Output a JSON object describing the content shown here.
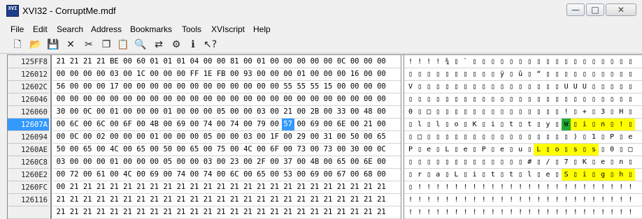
{
  "window": {
    "icon_label": "XVI",
    "title": "XVI32 - CorruptMe.mdf",
    "minimize": "—",
    "maximize": "□",
    "close": "✕"
  },
  "menu": [
    "File",
    "Edit",
    "Search",
    "Address",
    "Bookmarks",
    "Tools",
    "XVIscript",
    "Help"
  ],
  "toolbar": [
    {
      "name": "new-file-icon",
      "glyph": "🗋"
    },
    {
      "name": "open-folder-icon",
      "glyph": "📂"
    },
    {
      "name": "save-disk-icon",
      "glyph": "💾"
    },
    {
      "name": "delete-x-icon",
      "glyph": "✕"
    },
    {
      "name": "cut-scissors-icon",
      "glyph": "✂"
    },
    {
      "name": "copy-icon",
      "glyph": "❐"
    },
    {
      "name": "paste-clipboard-icon",
      "glyph": "📋"
    },
    {
      "name": "find-magnifier-icon",
      "glyph": "🔍"
    },
    {
      "name": "replace-icon",
      "glyph": "⇄"
    },
    {
      "name": "settings-icon",
      "glyph": "⚙"
    },
    {
      "name": "info-icon",
      "glyph": "ℹ"
    },
    {
      "name": "context-help-icon",
      "glyph": "↖?"
    }
  ],
  "colors": {
    "selection": "#3399ff",
    "highlight": "#ffff00",
    "cursor": "#22aa33"
  },
  "rows": [
    {
      "addr": "125FF8",
      "hex": [
        "21",
        "21",
        "21",
        "21",
        "BE",
        "00",
        "60",
        "01",
        "01",
        "01",
        "04",
        "00",
        "00",
        "81",
        "00",
        "01",
        "00",
        "00",
        "00",
        "00",
        "00",
        "0C",
        "00",
        "00",
        "00"
      ],
      "txt": [
        "!",
        "!",
        "!",
        "!",
        "¾",
        "▯",
        "`",
        "▯",
        "▯",
        "▯",
        "▯",
        "▯",
        "▯",
        "▯",
        "▯",
        "▯",
        "▯",
        "▯",
        "▯",
        "▯",
        "▯",
        "▯",
        "▯",
        "▯",
        "▯"
      ]
    },
    {
      "addr": "126012",
      "hex": [
        "00",
        "00",
        "00",
        "00",
        "03",
        "00",
        "1C",
        "00",
        "00",
        "00",
        "FF",
        "1E",
        "FB",
        "00",
        "93",
        "00",
        "00",
        "00",
        "01",
        "00",
        "00",
        "00",
        "16",
        "00",
        "00"
      ],
      "txt": [
        "▯",
        "▯",
        "▯",
        "▯",
        "▯",
        "▯",
        "▯",
        "▯",
        "▯",
        "▯",
        "ÿ",
        "▯",
        "û",
        "▯",
        "“",
        "▯",
        "▯",
        "▯",
        "▯",
        "▯",
        "▯",
        "▯",
        "▯",
        "▯",
        "▯"
      ]
    },
    {
      "addr": "12602C",
      "hex": [
        "56",
        "00",
        "00",
        "00",
        "17",
        "00",
        "00",
        "00",
        "00",
        "00",
        "00",
        "00",
        "00",
        "00",
        "00",
        "00",
        "00",
        "55",
        "55",
        "55",
        "15",
        "00",
        "00",
        "00",
        "00"
      ],
      "txt": [
        "V",
        "▯",
        "▯",
        "▯",
        "▯",
        "▯",
        "▯",
        "▯",
        "▯",
        "▯",
        "▯",
        "▯",
        "▯",
        "▯",
        "▯",
        "▯",
        "▯",
        "U",
        "U",
        "U",
        "▯",
        "▯",
        "▯",
        "▯",
        "▯"
      ]
    },
    {
      "addr": "126046",
      "hex": [
        "00",
        "00",
        "00",
        "00",
        "00",
        "00",
        "00",
        "00",
        "00",
        "00",
        "00",
        "00",
        "00",
        "00",
        "00",
        "00",
        "00",
        "00",
        "00",
        "00",
        "00",
        "00",
        "00",
        "00",
        "00"
      ],
      "txt": [
        "▯",
        "▯",
        "▯",
        "▯",
        "▯",
        "▯",
        "▯",
        "▯",
        "▯",
        "▯",
        "▯",
        "▯",
        "▯",
        "▯",
        "▯",
        "▯",
        "▯",
        "▯",
        "▯",
        "▯",
        "▯",
        "▯",
        "▯",
        "▯",
        "▯"
      ]
    },
    {
      "addr": "126060",
      "hex": [
        "30",
        "00",
        "0C",
        "00",
        "01",
        "00",
        "00",
        "00",
        "01",
        "00",
        "00",
        "00",
        "05",
        "00",
        "00",
        "03",
        "00",
        "21",
        "00",
        "2B",
        "00",
        "33",
        "00",
        "48",
        "00",
        "65"
      ],
      "txt": [
        "0",
        "▯",
        "□",
        "▯",
        "▯",
        "▯",
        "▯",
        "▯",
        "▯",
        "▯",
        "▯",
        "▯",
        "▯",
        "▯",
        "▯",
        "▯",
        "▯",
        "!",
        "▯",
        "+",
        "▯",
        "3",
        "▯",
        "H",
        "▯",
        "e"
      ]
    },
    {
      "addr": "12607A",
      "hex": [
        "00",
        "6C",
        "00",
        "6C",
        "00",
        "6F",
        "00",
        "4B",
        "00",
        "69",
        "00",
        "74",
        "00",
        "74",
        "00",
        "79",
        "00",
        "57",
        "00",
        "69",
        "00",
        "6E",
        "00",
        "21",
        "00",
        "30"
      ],
      "txt": [
        "▯",
        "l",
        "▯",
        "l",
        "▯",
        "o",
        "▯",
        "K",
        "▯",
        "i",
        "▯",
        "t",
        "▯",
        "t",
        "▯",
        "y",
        "▯",
        "W",
        "▯",
        "i",
        "▯",
        "n",
        "▯",
        "!",
        "▯",
        "0"
      ]
    },
    {
      "addr": "126094",
      "hex": [
        "00",
        "0C",
        "00",
        "02",
        "00",
        "00",
        "00",
        "01",
        "00",
        "00",
        "00",
        "05",
        "00",
        "00",
        "03",
        "00",
        "1F",
        "00",
        "29",
        "00",
        "31",
        "00",
        "50",
        "00",
        "65",
        "00"
      ],
      "txt": [
        "▯",
        "□",
        "▯",
        "▯",
        "▯",
        "▯",
        "▯",
        "▯",
        "▯",
        "▯",
        "▯",
        "▯",
        "▯",
        "▯",
        "▯",
        "▯",
        "▯",
        "▯",
        ")",
        "▯",
        "1",
        "▯",
        "P",
        "▯",
        "e",
        "▯"
      ]
    },
    {
      "addr": "1260AE",
      "hex": [
        "50",
        "00",
        "65",
        "00",
        "4C",
        "00",
        "65",
        "00",
        "50",
        "00",
        "65",
        "00",
        "75",
        "00",
        "4C",
        "00",
        "6F",
        "00",
        "73",
        "00",
        "73",
        "00",
        "30",
        "00",
        "0C",
        "00"
      ],
      "txt": [
        "P",
        "▯",
        "e",
        "▯",
        "L",
        "▯",
        "e",
        "▯",
        "P",
        "▯",
        "e",
        "▯",
        "u",
        "▯",
        "L",
        "▯",
        "o",
        "▯",
        "s",
        "▯",
        "s",
        "▯",
        "0",
        "▯",
        "□",
        "▯"
      ]
    },
    {
      "addr": "1260C8",
      "hex": [
        "03",
        "00",
        "00",
        "00",
        "01",
        "00",
        "00",
        "00",
        "05",
        "00",
        "00",
        "03",
        "00",
        "23",
        "00",
        "2F",
        "00",
        "37",
        "00",
        "4B",
        "00",
        "65",
        "00",
        "6E",
        "00",
        "64"
      ],
      "txt": [
        "▯",
        "▯",
        "▯",
        "▯",
        "▯",
        "▯",
        "▯",
        "▯",
        "▯",
        "▯",
        "▯",
        "▯",
        "▯",
        "#",
        "▯",
        "/",
        "▯",
        "7",
        "▯",
        "K",
        "▯",
        "e",
        "▯",
        "n",
        "▯",
        "d"
      ]
    },
    {
      "addr": "1260E2",
      "hex": [
        "00",
        "72",
        "00",
        "61",
        "00",
        "4C",
        "00",
        "69",
        "00",
        "74",
        "00",
        "74",
        "00",
        "6C",
        "00",
        "65",
        "00",
        "53",
        "00",
        "69",
        "00",
        "67",
        "00",
        "68",
        "00",
        "00"
      ],
      "txt": [
        "▯",
        "r",
        "▯",
        "a",
        "▯",
        "L",
        "▯",
        "i",
        "▯",
        "t",
        "▯",
        "t",
        "▯",
        "l",
        "▯",
        "e",
        "▯",
        "S",
        "▯",
        "i",
        "▯",
        "g",
        "▯",
        "h",
        "▯",
        "▯"
      ]
    },
    {
      "addr": "1260FC",
      "hex": [
        "00",
        "21",
        "21",
        "21",
        "21",
        "21",
        "21",
        "21",
        "21",
        "21",
        "21",
        "21",
        "21",
        "21",
        "21",
        "21",
        "21",
        "21",
        "21",
        "21",
        "21",
        "21",
        "21",
        "21",
        "21",
        "21"
      ],
      "txt": [
        "▯",
        "!",
        "!",
        "!",
        "!",
        "!",
        "!",
        "!",
        "!",
        "!",
        "!",
        "!",
        "!",
        "!",
        "!",
        "!",
        "!",
        "!",
        "!",
        "!",
        "!",
        "!",
        "!",
        "!",
        "!",
        "!"
      ]
    },
    {
      "addr": "126116",
      "hex": [
        "21",
        "21",
        "21",
        "21",
        "21",
        "21",
        "21",
        "21",
        "21",
        "21",
        "21",
        "21",
        "21",
        "21",
        "21",
        "21",
        "21",
        "21",
        "21",
        "21",
        "21",
        "21",
        "21",
        "21",
        "21",
        "21"
      ],
      "txt": [
        "!",
        "!",
        "!",
        "!",
        "!",
        "!",
        "!",
        "!",
        "!",
        "!",
        "!",
        "!",
        "!",
        "!",
        "!",
        "!",
        "!",
        "!",
        "!",
        "!",
        "!",
        "!",
        "!",
        "!",
        "!",
        "!"
      ]
    },
    {
      "addr": "",
      "hex": [
        "21",
        "21",
        "21",
        "21",
        "21",
        "21",
        "21",
        "21",
        "21",
        "21",
        "21",
        "21",
        "21",
        "21",
        "21",
        "21",
        "21",
        "21",
        "21",
        "21",
        "21",
        "21",
        "21",
        "21",
        "21",
        "21"
      ],
      "txt": [
        "!",
        "!",
        "!",
        "!",
        "!",
        "!",
        "!",
        "!",
        "!",
        "!",
        "!",
        "!",
        "!",
        "!",
        "!",
        "!",
        "!",
        "!",
        "!",
        "!",
        "!",
        "!",
        "!",
        "!",
        "!",
        "!"
      ]
    }
  ],
  "selected_row": 5,
  "selected_hex_col": 17,
  "cursor_txt": {
    "row": 5,
    "col": 17
  },
  "highlight_txt": [
    {
      "row": 5,
      "from": 17,
      "to": 24
    },
    {
      "row": 7,
      "from": 14,
      "to": 20
    },
    {
      "row": 9,
      "from": 17,
      "to": 24
    }
  ]
}
